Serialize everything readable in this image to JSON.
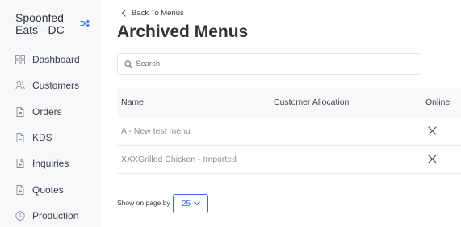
{
  "sidebar": {
    "brand": "Spoonfed Eats - DC",
    "switch_icon": "shuffle-icon",
    "items": [
      {
        "label": "Dashboard",
        "icon": "grid-icon"
      },
      {
        "label": "Customers",
        "icon": "users-icon"
      },
      {
        "label": "Orders",
        "icon": "document-icon"
      },
      {
        "label": "KDS",
        "icon": "document-icon"
      },
      {
        "label": "Inquiries",
        "icon": "document-plus-icon"
      },
      {
        "label": "Quotes",
        "icon": "document-plus-icon"
      },
      {
        "label": "Production",
        "icon": "clock-icon"
      }
    ]
  },
  "header": {
    "back_label": "Back To Menus",
    "title": "Archived Menus"
  },
  "search": {
    "placeholder": "Search",
    "value": ""
  },
  "table": {
    "columns": [
      "Name",
      "Customer Allocation",
      "Online"
    ],
    "rows": [
      {
        "name": "A - New test menu",
        "customer_allocation": "",
        "online": "close-icon"
      },
      {
        "name": "XXXGrilled Chicken - Imported",
        "customer_allocation": "",
        "online": "close-icon"
      }
    ]
  },
  "pagination": {
    "label": "Show on page by",
    "page_size": "25",
    "options": [
      "25"
    ]
  },
  "colors": {
    "sidebar_bg": "#f7f8f9",
    "accent": "#2d6fd6",
    "text": "#3c4046",
    "muted_text": "#8a8f96"
  }
}
